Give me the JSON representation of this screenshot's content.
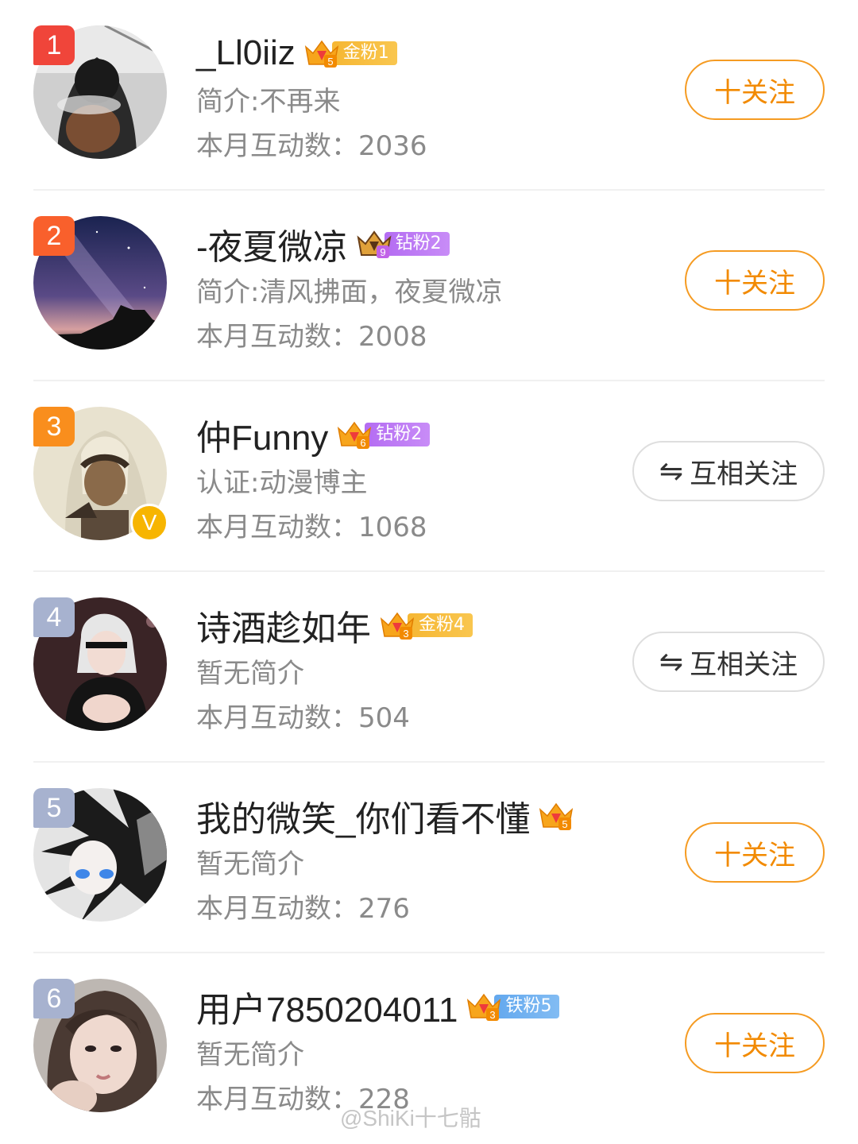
{
  "follow_label": "十关注",
  "mutual_label": "互相关注",
  "icons": {
    "follow": "plus-icon",
    "mutual": "swap-arrows-icon",
    "crown": "crown-icon",
    "verified": "verified-v-icon"
  },
  "colors": {
    "accent": "#f28a00",
    "rank_1": "#f0453a",
    "rank_2": "#f9602c",
    "rank_3": "#f98e1d",
    "rank_other": "#a7b2cf"
  },
  "users": [
    {
      "rank": "1",
      "name": "_Ll0iiz",
      "crown_level": "5",
      "badge": "金粉1",
      "badge_type": "gold",
      "bio": "简介:不再来",
      "stat_label": "本月互动数：",
      "stat_value": "2036",
      "button": "follow",
      "verified": false
    },
    {
      "rank": "2",
      "name": "-夜夏微凉",
      "crown_level": "9",
      "badge": "钻粉2",
      "badge_type": "diamond",
      "bio": "简介:清风拂面，夜夏微凉",
      "stat_label": "本月互动数：",
      "stat_value": "2008",
      "button": "follow",
      "verified": false
    },
    {
      "rank": "3",
      "name": "仲Funny",
      "crown_level": "6",
      "badge": "钻粉2",
      "badge_type": "diamond",
      "bio": "认证:动漫博主",
      "stat_label": "本月互动数：",
      "stat_value": "1068",
      "button": "mutual",
      "verified": true,
      "verified_label": "V"
    },
    {
      "rank": "4",
      "name": "诗酒趁如年",
      "crown_level": "3",
      "badge": "金粉4",
      "badge_type": "gold",
      "bio": "暂无简介",
      "stat_label": "本月互动数：",
      "stat_value": "504",
      "button": "mutual",
      "verified": false
    },
    {
      "rank": "5",
      "name": "我的微笑_你们看不懂",
      "crown_level": "5",
      "badge": "",
      "badge_type": "none",
      "bio": "暂无简介",
      "stat_label": "本月互动数：",
      "stat_value": "276",
      "button": "follow",
      "verified": false
    },
    {
      "rank": "6",
      "name": "用户7850204011",
      "crown_level": "3",
      "badge": "铁粉5",
      "badge_type": "iron",
      "bio": "暂无简介",
      "stat_label": "本月互动数：",
      "stat_value": "228",
      "button": "follow",
      "verified": false
    }
  ],
  "watermark": "@ShiKi十七骷"
}
